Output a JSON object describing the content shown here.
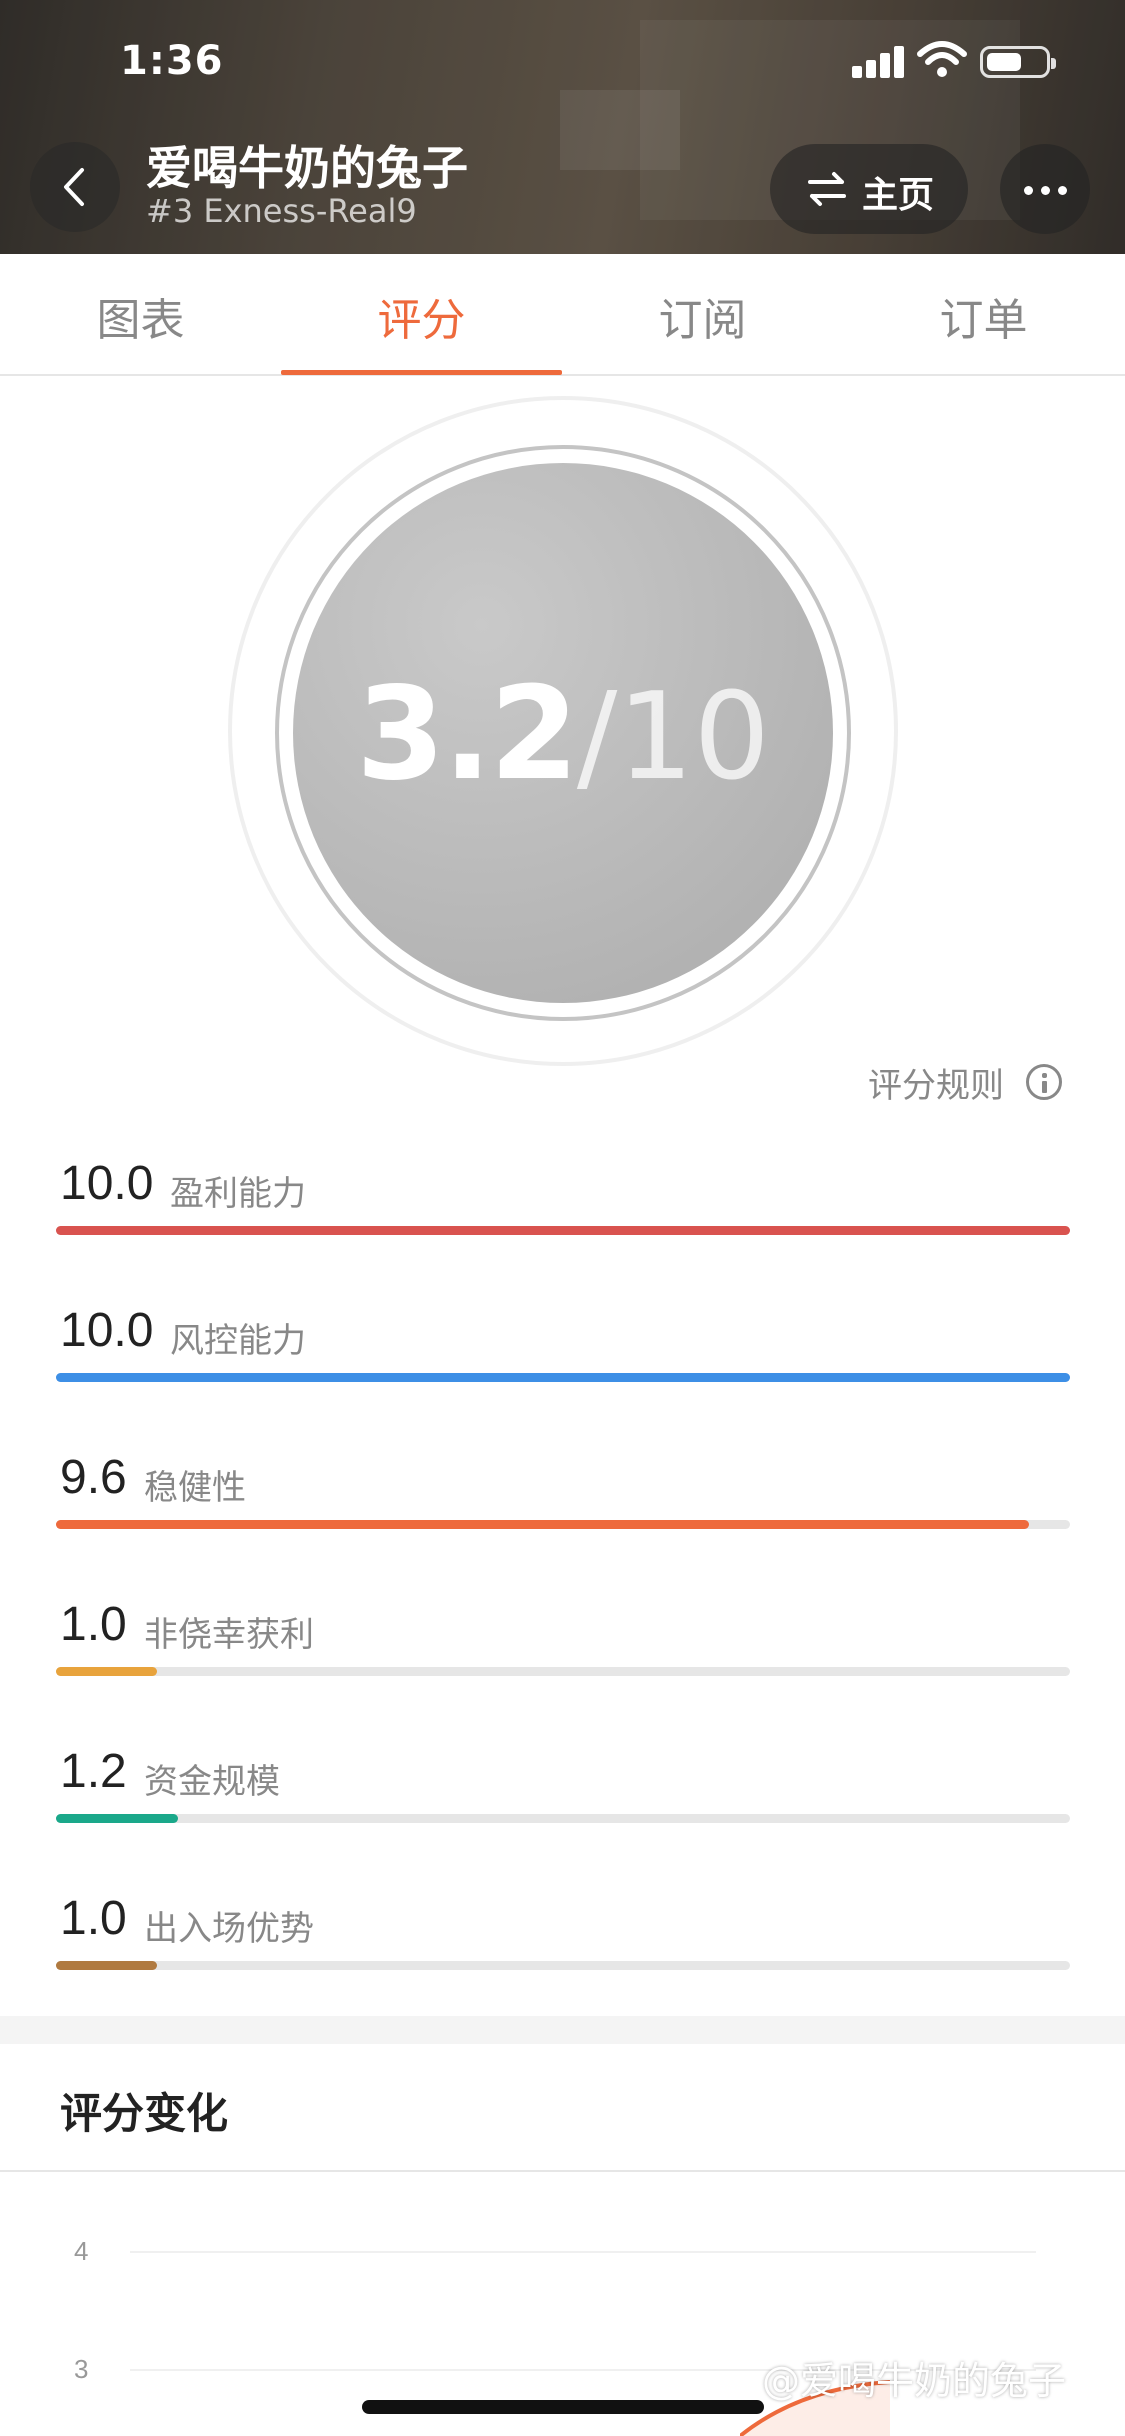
{
  "status_bar": {
    "time": "1:36"
  },
  "header": {
    "title": "爱喝牛奶的兔子",
    "subtitle": "#3 Exness-Real9",
    "home_button_label": "主页"
  },
  "tabs": [
    {
      "label": "图表",
      "active": false
    },
    {
      "label": "评分",
      "active": true
    },
    {
      "label": "订阅",
      "active": false
    },
    {
      "label": "订单",
      "active": false
    }
  ],
  "score": {
    "value": "3.2",
    "total": "/10"
  },
  "rules_link": "评分规则",
  "metrics": [
    {
      "value": "10.0",
      "label": "盈利能力",
      "fraction": 1.0,
      "color": "#d9534f"
    },
    {
      "value": "10.0",
      "label": "风控能力",
      "fraction": 1.0,
      "color": "#3d8fe6"
    },
    {
      "value": "9.6",
      "label": "稳健性",
      "fraction": 0.96,
      "color": "#ee6a3c"
    },
    {
      "value": "1.0",
      "label": "非侥幸获利",
      "fraction": 0.1,
      "color": "#e8a33c"
    },
    {
      "value": "1.2",
      "label": "资金规模",
      "fraction": 0.12,
      "color": "#1aa88a"
    },
    {
      "value": "1.0",
      "label": "出入场优势",
      "fraction": 0.1,
      "color": "#b07a40"
    }
  ],
  "score_change": {
    "title": "评分变化",
    "y_ticks": [
      "4",
      "3"
    ]
  },
  "watermark": "@爱喝牛奶的兔子",
  "colors": {
    "accent": "#ee6a3c"
  }
}
